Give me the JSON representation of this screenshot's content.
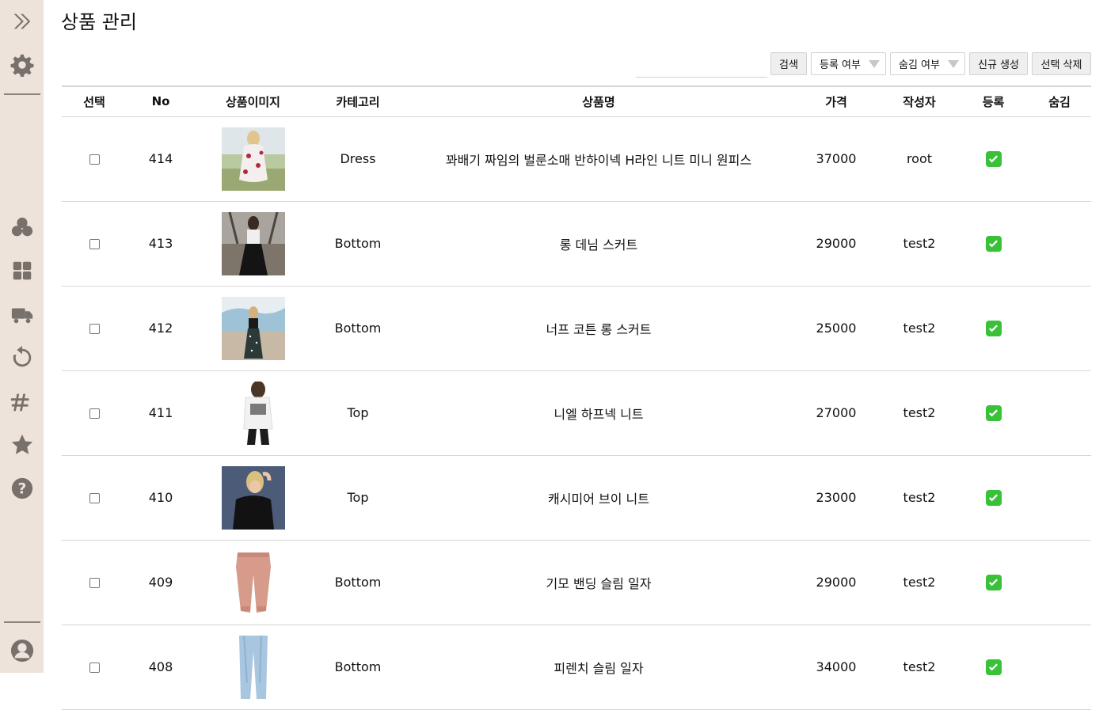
{
  "page": {
    "title": "상품 관리"
  },
  "sidebar": {
    "top_icons": [
      "expand-icon",
      "gear-icon"
    ],
    "nav_icons": [
      "clover-icon",
      "grid-icon",
      "delivery-icon",
      "refresh-icon",
      "hashtag-icon",
      "star-icon",
      "help-icon"
    ],
    "bottom_icons": [
      "user-icon"
    ]
  },
  "toolbar": {
    "search_placeholder": "",
    "search_label": "검색",
    "registered_filter": "등록 여부",
    "hidden_filter": "숨김 여부",
    "create_label": "신규 생성",
    "delete_label": "선택 삭제"
  },
  "table": {
    "columns": [
      "선택",
      "No",
      "상품이미지",
      "카테고리",
      "상품명",
      "가격",
      "작성자",
      "등록",
      "숨김"
    ],
    "rows": [
      {
        "no": "414",
        "image": "dress-floral-photo",
        "category": "Dress",
        "name": "꽈배기 짜임의 벌룬소매 반하이넥 H라인 니트 미니 원피스",
        "price": "37000",
        "author": "root",
        "registered": "✅",
        "hidden": ""
      },
      {
        "no": "413",
        "image": "black-long-skirt-photo",
        "category": "Bottom",
        "name": "롱 데님 스커트",
        "price": "29000",
        "author": "test2",
        "registered": "✅",
        "hidden": ""
      },
      {
        "no": "412",
        "image": "dotted-long-skirt-photo",
        "category": "Bottom",
        "name": "너프 코튼 롱 스커트",
        "price": "25000",
        "author": "test2",
        "registered": "✅",
        "hidden": ""
      },
      {
        "no": "411",
        "image": "white-tshirt-photo",
        "category": "Top",
        "name": "니엘 하프넥 니트",
        "price": "27000",
        "author": "test2",
        "registered": "✅",
        "hidden": ""
      },
      {
        "no": "410",
        "image": "black-tshirt-photo",
        "category": "Top",
        "name": "캐시미어 브이 니트",
        "price": "23000",
        "author": "test2",
        "registered": "✅",
        "hidden": ""
      },
      {
        "no": "409",
        "image": "pink-jogger-photo",
        "category": "Bottom",
        "name": "기모 밴딩 슬림 일자",
        "price": "29000",
        "author": "test2",
        "registered": "✅",
        "hidden": ""
      },
      {
        "no": "408",
        "image": "light-jeans-photo",
        "category": "Bottom",
        "name": "피렌치 슬림 일자",
        "price": "34000",
        "author": "test2",
        "registered": "✅",
        "hidden": ""
      }
    ]
  },
  "colors": {
    "sidebar_bg": "#ede3da",
    "sidebar_icon": "#77706b",
    "check_green": "#39c138"
  }
}
